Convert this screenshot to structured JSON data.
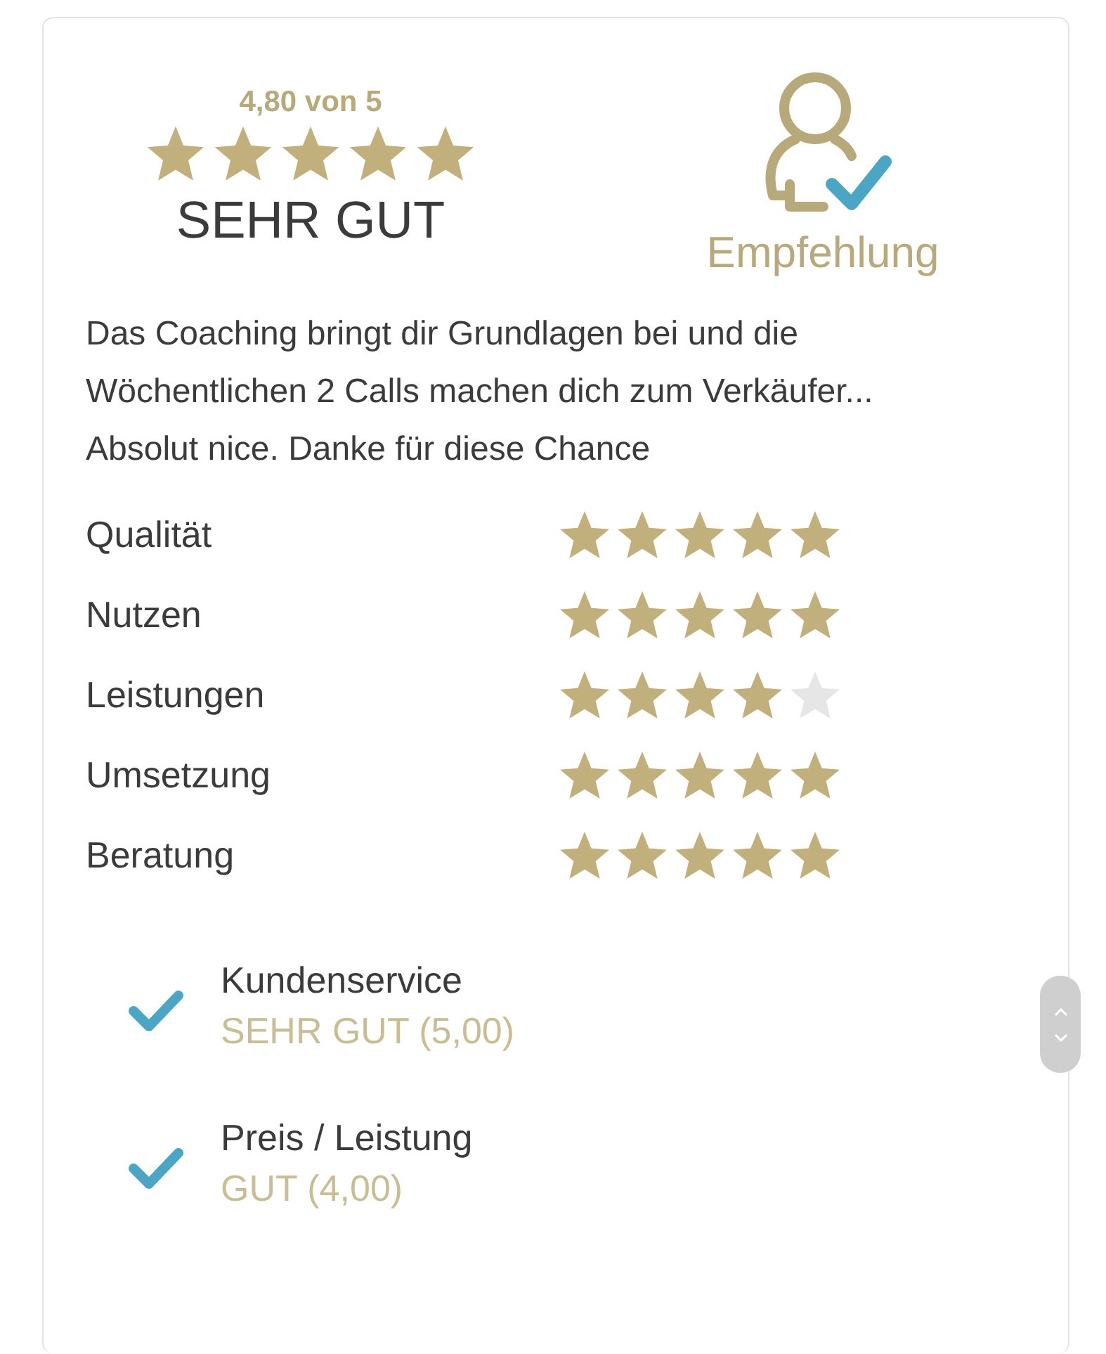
{
  "summary": {
    "score": "4,80 von 5",
    "stars": 5,
    "verdict": "SEHR GUT",
    "recommendation": "Empfehlung"
  },
  "review": "Das Coaching bringt dir Grundlagen bei und die Wöchentlichen 2 Calls machen dich zum Verkäufer... Absolut nice. Danke für diese Chance",
  "criteria": [
    {
      "label": "Qualität",
      "stars": 5
    },
    {
      "label": "Nutzen",
      "stars": 5
    },
    {
      "label": "Leistungen",
      "stars": 4
    },
    {
      "label": "Umsetzung",
      "stars": 5
    },
    {
      "label": "Beratung",
      "stars": 5
    }
  ],
  "aspects": [
    {
      "label": "Kundenservice",
      "rating": "SEHR GUT (5,00)",
      "checked": true
    },
    {
      "label": "Preis / Leistung",
      "rating": "GUT (4,00)",
      "checked": true
    }
  ]
}
